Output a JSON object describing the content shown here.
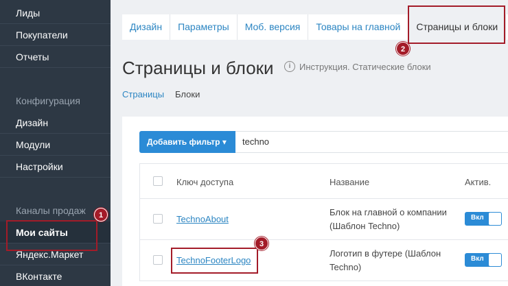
{
  "sidebar": {
    "items": [
      {
        "label": "Лиды"
      },
      {
        "label": "Покупатели"
      },
      {
        "label": "Отчеты"
      }
    ],
    "config_header": "Конфигурация",
    "config_items": [
      {
        "label": "Дизайн"
      },
      {
        "label": "Модули"
      },
      {
        "label": "Настройки"
      }
    ],
    "channels_header": "Каналы продаж",
    "channel_items": [
      {
        "label": "Мои сайты"
      },
      {
        "label": "Яндекс.Маркет"
      },
      {
        "label": "ВКонтакте"
      }
    ]
  },
  "tabs": [
    {
      "label": "Дизайн"
    },
    {
      "label": "Параметры"
    },
    {
      "label": "Моб. версия"
    },
    {
      "label": "Товары на главной"
    },
    {
      "label": "Страницы и блоки"
    }
  ],
  "page": {
    "title": "Страницы и блоки",
    "instruction": "Инструкция. Статические блоки",
    "subnav": {
      "pages": "Страницы",
      "blocks": "Блоки"
    }
  },
  "filter": {
    "button_label": "Добавить фильтр",
    "value": "techno"
  },
  "table": {
    "headers": {
      "key": "Ключ доступа",
      "name": "Название",
      "active": "Актив."
    },
    "rows": [
      {
        "key": "TechnoAbout",
        "name": "Блок на главной о компании (Шаблон Techno)",
        "toggle": "Вкл"
      },
      {
        "key": "TechnoFooterLogo",
        "name": "Логотип в футере (Шаблон Techno)",
        "toggle": "Вкл"
      }
    ]
  },
  "annotations": {
    "badge1": "1",
    "badge2": "2",
    "badge3": "3"
  },
  "colors": {
    "sidebar_bg": "#2d3844",
    "accent": "#2b8bd6",
    "link": "#2b85c2",
    "highlight": "#a31b28"
  }
}
